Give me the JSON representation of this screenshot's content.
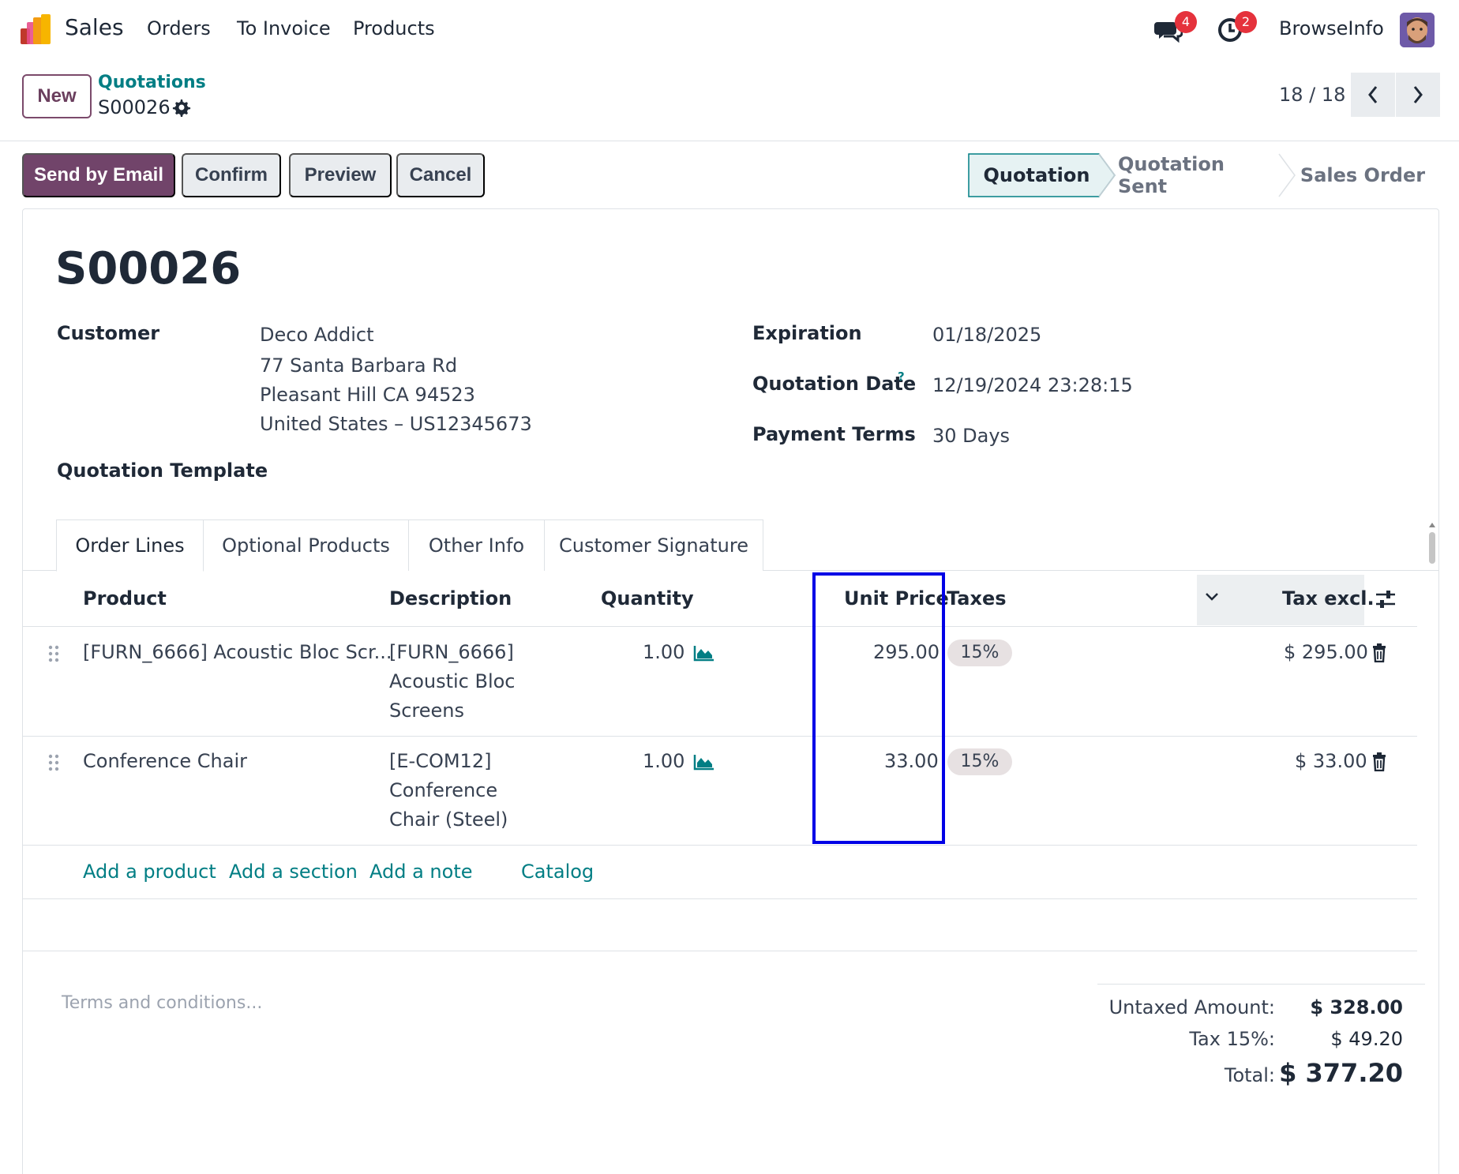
{
  "navbar": {
    "app_name": "Sales",
    "menu": [
      "Orders",
      "To Invoice",
      "Products"
    ],
    "messages_count": "4",
    "activities_count": "2",
    "user_name": "BrowseInfo"
  },
  "control_panel": {
    "new_label": "New",
    "breadcrumb": "Quotations",
    "record_name": "S00026",
    "pager": "18 / 18"
  },
  "actions": {
    "send_email": "Send by Email",
    "confirm": "Confirm",
    "preview": "Preview",
    "cancel": "Cancel"
  },
  "statusbar": [
    "Quotation",
    "Quotation Sent",
    "Sales Order"
  ],
  "form": {
    "title": "S00026",
    "customer_label": "Customer",
    "customer_lines": [
      "Deco Addict",
      "77 Santa Barbara Rd",
      "Pleasant Hill CA 94523",
      "United States – US12345673"
    ],
    "template_label": "Quotation Template",
    "expiration_label": "Expiration",
    "expiration_value": "01/18/2025",
    "quotation_date_label": "Quotation Date",
    "quotation_date_help": "?",
    "quotation_date_value": "12/19/2024 23:28:15",
    "payment_terms_label": "Payment Terms",
    "payment_terms_value": "30 Days"
  },
  "tabs": [
    "Order Lines",
    "Optional Products",
    "Other Info",
    "Customer Signature"
  ],
  "table": {
    "headers": {
      "product": "Product",
      "description": "Description",
      "quantity": "Quantity",
      "unit_price": "Unit Price",
      "taxes": "Taxes",
      "tax_excl": "Tax excl."
    },
    "rows": [
      {
        "product": "[FURN_6666] Acoustic Bloc Scr...",
        "description": [
          "[FURN_6666]",
          "Acoustic Bloc",
          "Screens"
        ],
        "quantity": "1.00",
        "unit_price": "295.00",
        "tax": "15%",
        "subtotal": "$ 295.00"
      },
      {
        "product": "Conference Chair",
        "description": [
          "[E-COM12]",
          "Conference",
          "Chair (Steel)"
        ],
        "quantity": "1.00",
        "unit_price": "33.00",
        "tax": "15%",
        "subtotal": "$ 33.00"
      }
    ],
    "add_product": "Add a product",
    "add_section": "Add a section",
    "add_note": "Add a note",
    "catalog": "Catalog"
  },
  "footer": {
    "terms_placeholder": "Terms and conditions...",
    "untaxed_label": "Untaxed Amount:",
    "untaxed_value": "$ 328.00",
    "tax_label": "Tax 15%:",
    "tax_value": "$ 49.20",
    "total_label": "Total:",
    "total_value": "$ 377.20"
  },
  "colors": {
    "brand_primary": "#71446a",
    "link": "#017e84",
    "highlight_box": "#0000e6",
    "badge": "#e5323c"
  }
}
